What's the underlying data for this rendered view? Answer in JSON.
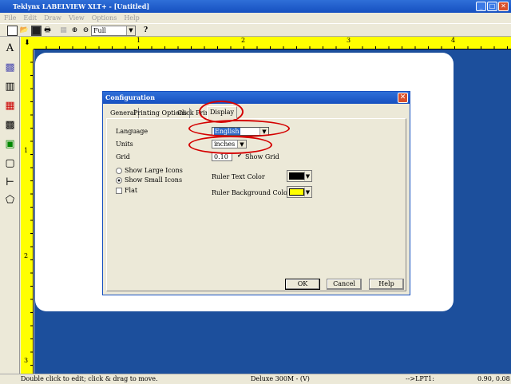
{
  "window": {
    "title": "Teklynx LABELVIEW XLT+  - [Untitled]",
    "minimize": "_",
    "maximize": "□",
    "close": "✕"
  },
  "menu": [
    "File",
    "Edit",
    "Draw",
    "View",
    "Options",
    "Help"
  ],
  "toolbar": {
    "zoom_value": "Full"
  },
  "ruler": {
    "top_numbers": [
      "1",
      "2",
      "3",
      "4"
    ],
    "left_numbers": [
      "1",
      "2",
      "3"
    ]
  },
  "dialog": {
    "title": "Configuration",
    "tabs": [
      "General",
      "Printing Options",
      "Click Print",
      "Display"
    ],
    "active_tab": "Display",
    "language_label": "Language",
    "language_value": "English",
    "units_label": "Units",
    "units_value": "inches",
    "grid_label": "Grid",
    "grid_value": "0.10",
    "show_grid_label": "Show Grid",
    "show_grid_checked": true,
    "show_large_icons": "Show Large Icons",
    "show_small_icons": "Show Small Icons",
    "selected_icon_size": "small",
    "flat_label": "Flat",
    "flat_checked": false,
    "ruler_text_color_label": "Ruler Text Color",
    "ruler_text_color": "#000000",
    "ruler_bg_color_label": "Ruler Background Color",
    "ruler_bg_color": "#ffff00",
    "ok": "OK",
    "cancel": "Cancel",
    "help": "Help"
  },
  "status": {
    "hint": "Double click to edit; click & drag to move.",
    "printer": "Deluxe 300M - (V)",
    "port": "-->LPT1:",
    "coords": "0.90, 0.08"
  }
}
